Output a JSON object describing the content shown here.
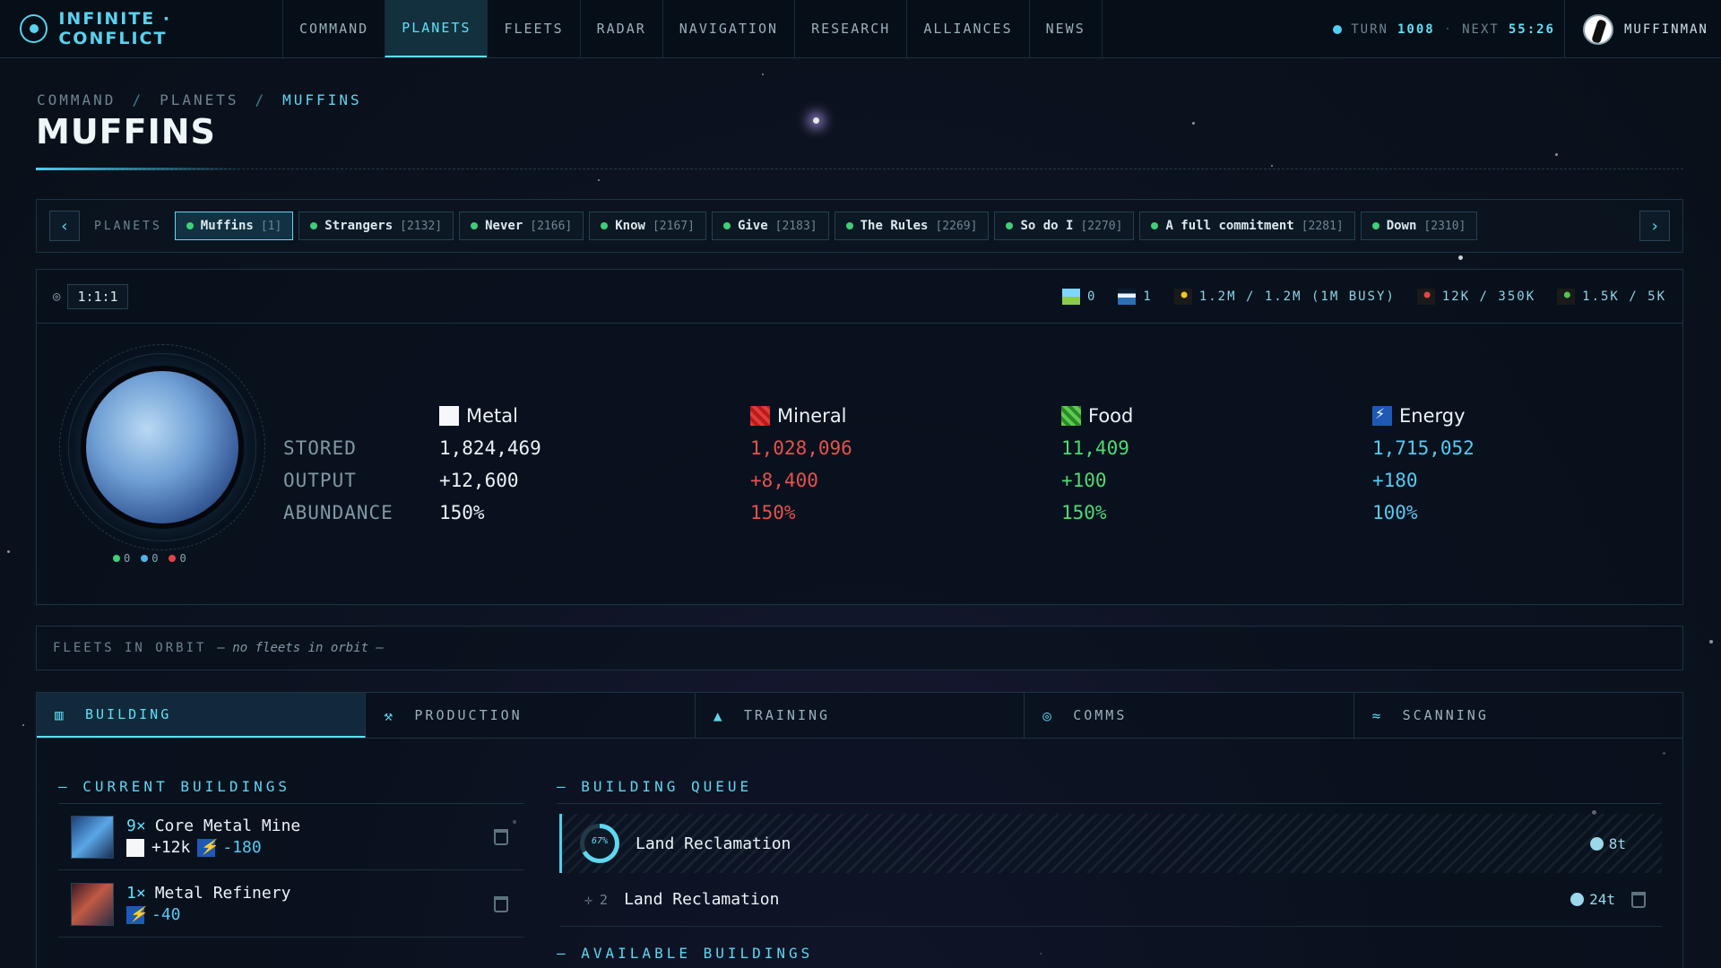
{
  "app": {
    "title": "INFINITE · CONFLICT"
  },
  "nav": [
    {
      "label": "COMMAND"
    },
    {
      "label": "PLANETS",
      "active": true
    },
    {
      "label": "FLEETS"
    },
    {
      "label": "RADAR"
    },
    {
      "label": "NAVIGATION"
    },
    {
      "label": "RESEARCH"
    },
    {
      "label": "ALLIANCES"
    },
    {
      "label": "NEWS"
    }
  ],
  "turn": {
    "label": "TURN",
    "value": "1008",
    "next_label": "NEXT",
    "next_value": "55:26",
    "sep": "·"
  },
  "user": {
    "name": "MUFFINMAN"
  },
  "breadcrumb": {
    "items": [
      "COMMAND",
      "PLANETS",
      "MUFFINS"
    ],
    "sep": "/"
  },
  "page": {
    "title": "MUFFINS"
  },
  "planet_strip": {
    "label": "PLANETS",
    "prev_icon": "‹",
    "next_icon": "›",
    "planets": [
      {
        "name": "Muffins",
        "id": "[1]",
        "active": true
      },
      {
        "name": "Strangers",
        "id": "[2132]"
      },
      {
        "name": "Never",
        "id": "[2166]"
      },
      {
        "name": "Know",
        "id": "[2167]"
      },
      {
        "name": "Give",
        "id": "[2183]"
      },
      {
        "name": "The Rules",
        "id": "[2269]"
      },
      {
        "name": "So do I",
        "id": "[2270]"
      },
      {
        "name": "A full commitment",
        "id": "[2281]"
      },
      {
        "name": "Down",
        "id": "[2310]"
      }
    ]
  },
  "planet": {
    "coords": "1:1:1",
    "stats": {
      "land": "0",
      "water": "1",
      "population": "1.2M / 1.2M (1M BUSY)",
      "military": "12K / 350K",
      "agri": "1.5K / 5K"
    },
    "counts": [
      {
        "value": "0",
        "color": "#3fcf77"
      },
      {
        "value": "0",
        "color": "#4fb4e8"
      },
      {
        "value": "0",
        "color": "#e04545"
      }
    ],
    "row_labels": {
      "stored": "STORED",
      "output": "OUTPUT",
      "abundance": "ABUNDANCE"
    },
    "resources": [
      {
        "name": "Metal",
        "icon": "metal-icon",
        "stored": "1,824,469",
        "output": "+12,600",
        "abundance": "150%",
        "color": "#eaf3f6"
      },
      {
        "name": "Mineral",
        "icon": "mineral-icon",
        "stored": "1,028,096",
        "output": "+8,400",
        "abundance": "150%",
        "color": "#e8504e"
      },
      {
        "name": "Food",
        "icon": "food-icon",
        "stored": "11,409",
        "output": "+100",
        "abundance": "150%",
        "color": "#4fda73"
      },
      {
        "name": "Energy",
        "icon": "energy-icon",
        "stored": "1,715,052",
        "output": "+180",
        "abundance": "100%",
        "color": "#58c9f2"
      }
    ]
  },
  "fleets": {
    "label": "FLEETS IN ORBIT",
    "empty": "— no fleets in orbit —"
  },
  "tabs": [
    {
      "label": "BUILDING",
      "icon": "factory-icon",
      "active": true
    },
    {
      "label": "PRODUCTION",
      "icon": "hammer-icon"
    },
    {
      "label": "TRAINING",
      "icon": "graduation-cap-icon"
    },
    {
      "label": "COMMS",
      "icon": "satellite-icon"
    },
    {
      "label": "SCANNING",
      "icon": "wifi-icon"
    }
  ],
  "building": {
    "current_title": "— CURRENT BUILDINGS",
    "queue_title": "— BUILDING QUEUE",
    "available_title": "— AVAILABLE BUILDINGS",
    "current": [
      {
        "count": "9×",
        "name": "Core Metal Mine",
        "eff1": "+12k",
        "eff2": "-180"
      },
      {
        "count": "1×",
        "name": "Metal Refinery",
        "eff2": "-40"
      }
    ],
    "queue": [
      {
        "progress": 0.67,
        "progress_label": "67%",
        "name": "Land Reclamation",
        "time": "8t"
      },
      {
        "position": "2",
        "name": "Land Reclamation",
        "time": "24t"
      }
    ]
  }
}
